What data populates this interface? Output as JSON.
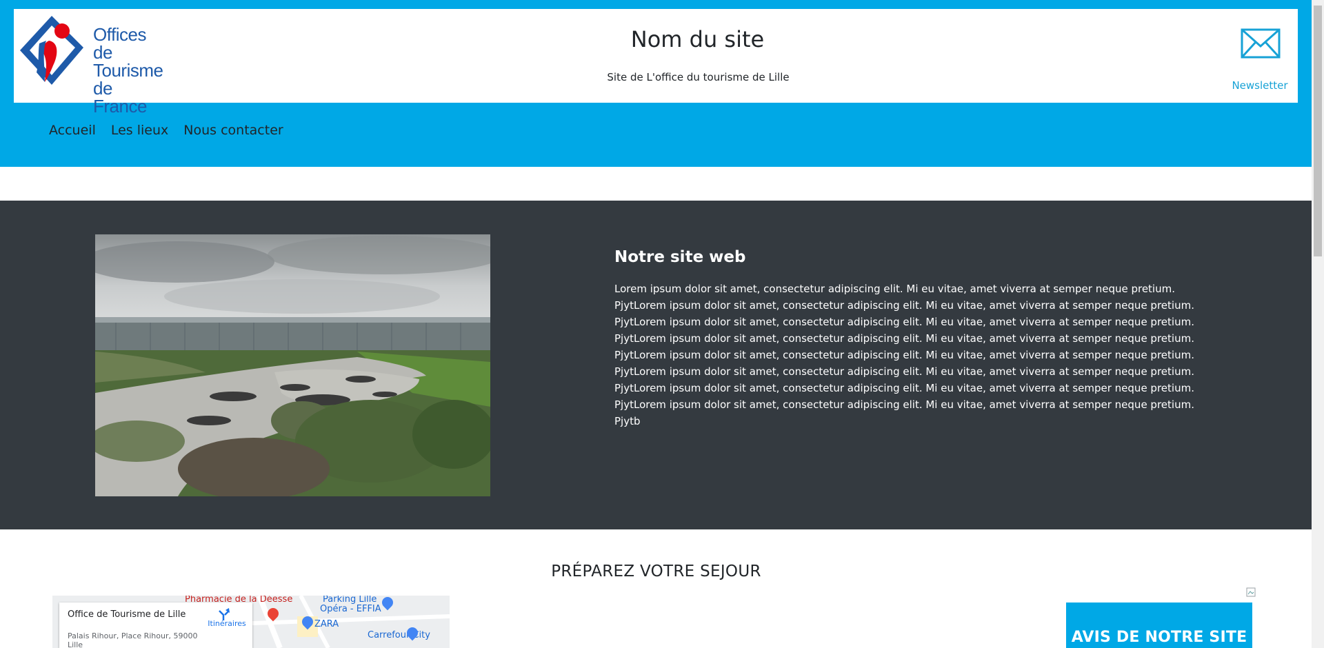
{
  "header": {
    "logo_lines": [
      "Offices de",
      "Tourisme",
      "de France"
    ],
    "site_title": "Nom du site",
    "site_subtitle": "Site de L'office du tourisme de Lille",
    "newsletter_label": "Newsletter"
  },
  "nav": {
    "items": [
      {
        "label": "Accueil"
      },
      {
        "label": "Les lieux"
      },
      {
        "label": "Nous contacter"
      }
    ]
  },
  "about": {
    "title": "Notre site web",
    "text": "Lorem ipsum dolor sit amet, consectetur adipiscing elit. Mi eu vitae, amet viverra at semper neque pretium. PjytLorem ipsum dolor sit amet, consectetur adipiscing elit. Mi eu vitae, amet viverra at semper neque pretium. PjytLorem ipsum dolor sit amet, consectetur adipiscing elit. Mi eu vitae, amet viverra at semper neque pretium. PjytLorem ipsum dolor sit amet, consectetur adipiscing elit. Mi eu vitae, amet viverra at semper neque pretium. PjytLorem ipsum dolor sit amet, consectetur adipiscing elit. Mi eu vitae, amet viverra at semper neque pretium. PjytLorem ipsum dolor sit amet, consectetur adipiscing elit. Mi eu vitae, amet viverra at semper neque pretium. PjytLorem ipsum dolor sit amet, consectetur adipiscing elit. Mi eu vitae, amet viverra at semper neque pretium. PjytLorem ipsum dolor sit amet, consectetur adipiscing elit. Mi eu vitae, amet viverra at semper neque pretium. Pjytb"
  },
  "sejour": {
    "title": "PRÉPAREZ VOTRE SEJOUR"
  },
  "map": {
    "place_name": "Office de Tourisme de Lille",
    "address": "Palais Rihour, Place Rihour, 59000 Lille",
    "directions_label": "Itinéraires",
    "pois": [
      "Pharmacie de la Déesse",
      "Parking Lille",
      "Opéra - EFFIA",
      "ZARA",
      "Carrefour City"
    ]
  },
  "avis": {
    "title": "AVIS DE NOTRE SITE"
  },
  "colors": {
    "brand_blue": "#00a8e6",
    "dark_section": "#343a40",
    "link_blue": "#17a2d6",
    "logo_blue": "#1e5aa9",
    "logo_red": "#e30613"
  }
}
